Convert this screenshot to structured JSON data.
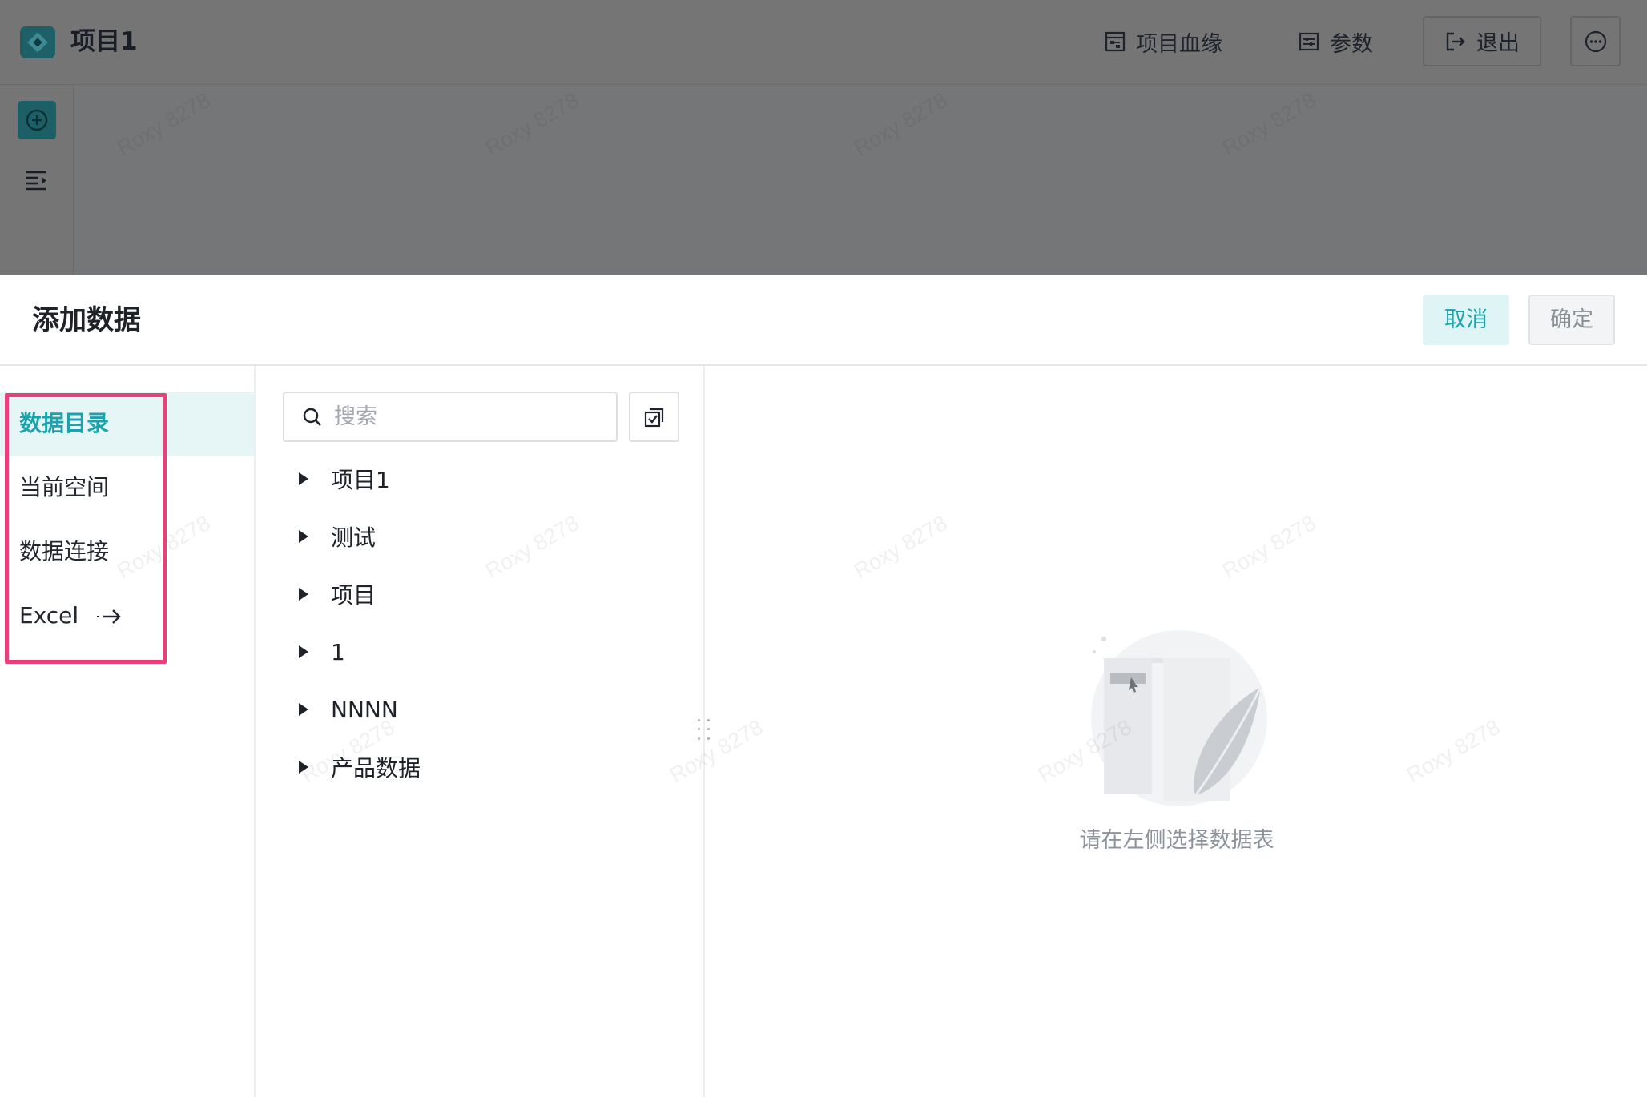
{
  "app": {
    "title": "项目1"
  },
  "toolbar": {
    "lineage_label": "项目血缘",
    "params_label": "参数",
    "exit_label": "退出"
  },
  "dialog": {
    "title": "添加数据",
    "cancel_label": "取消",
    "ok_label": "确定"
  },
  "nav": {
    "items": [
      {
        "label": "数据目录",
        "active": true
      },
      {
        "label": "当前空间",
        "active": false
      },
      {
        "label": "数据连接",
        "active": false
      },
      {
        "label": "Excel",
        "active": false
      }
    ]
  },
  "search": {
    "placeholder": "搜索",
    "value": ""
  },
  "tree": {
    "nodes": [
      "项目1",
      "测试",
      "项目",
      "1",
      "NNNN",
      "产品数据"
    ]
  },
  "preview": {
    "empty_text": "请在左侧选择数据表"
  },
  "watermark": {
    "text": "Roxy 8278"
  },
  "colors": {
    "accent": "#1aa3ad",
    "accent_bg": "#e6f6f6",
    "highlight_box": "#ea3f7a",
    "overlay_mask": "#757677"
  },
  "icons": {
    "app_logo": "app-logo-icon",
    "lineage": "lineage-icon",
    "params": "params-icon",
    "exit": "exit-icon",
    "more": "more-icon",
    "add": "add-circle-icon",
    "list": "list-indent-icon",
    "search": "search-icon",
    "batch_select": "batch-select-icon",
    "caret": "caret-right-icon",
    "arrow": "arrow-right-icon"
  }
}
